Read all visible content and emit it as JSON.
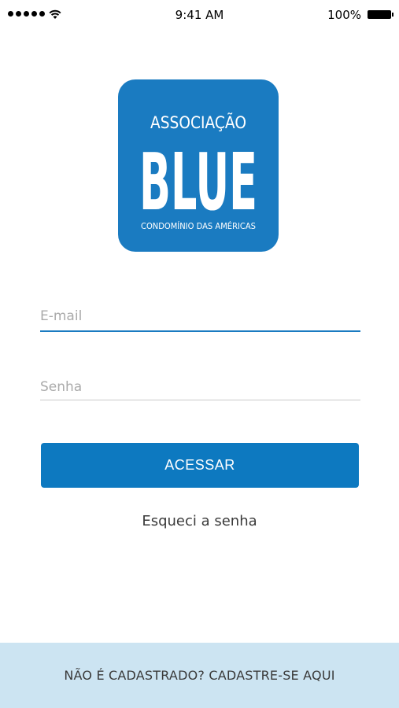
{
  "status_bar": {
    "time": "9:41 AM",
    "battery_percent": "100%",
    "icons": [
      "signal-dots-icon",
      "wifi-icon",
      "battery-icon"
    ]
  },
  "logo": {
    "line1": "ASSOCIAÇÃO",
    "line2": "BLUE",
    "line3": "CONDOMÍNIO DAS AMÉRICAS",
    "color": "#1a7bc1"
  },
  "login": {
    "email_placeholder": "E-mail",
    "password_placeholder": "Senha",
    "submit_label": "ACESSAR",
    "forgot_label": "Esqueci a senha"
  },
  "footer": {
    "signup_label": "NÃO É CADASTRADO? CADASTRE-SE AQUI"
  },
  "colors": {
    "accent": "#0d79c0",
    "footer_bg": "#cce4f2"
  }
}
